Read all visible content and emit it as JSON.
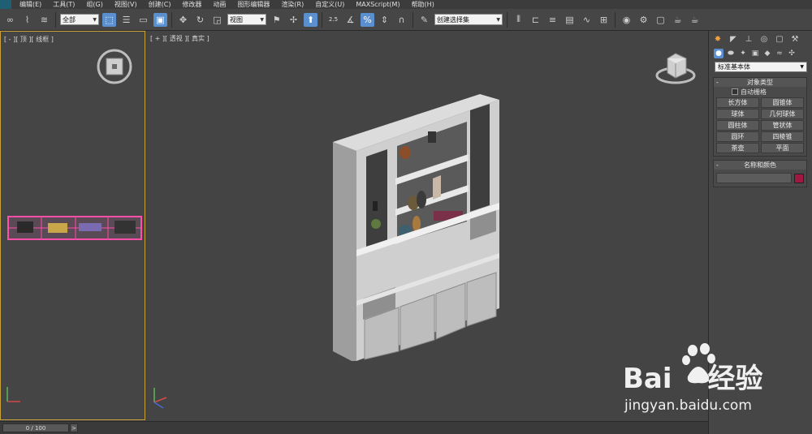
{
  "menubar": {
    "items": [
      "编辑(E)",
      "工具(T)",
      "组(G)",
      "视图(V)",
      "创建(C)",
      "修改器",
      "动画",
      "图形编辑器",
      "渲染(R)",
      "自定义(U)",
      "MAXScript(M)",
      "帮助(H)"
    ]
  },
  "toolbar": {
    "filter_select": "全部",
    "coord_select": "视图",
    "snap_label": "2.5",
    "named_selection": "创建选择集",
    "accent_color": "#5a8fd0"
  },
  "viewports": {
    "top": {
      "label": "[ - ][ 顶 ][ 线框 ]"
    },
    "perspective": {
      "label": "[ + ][ 透视 ][ 真实 ]"
    }
  },
  "command_panel": {
    "primitive_type": "标准基本体",
    "object_type": {
      "title": "对象类型",
      "autogrid": "自动栅格",
      "buttons": [
        "长方体",
        "圆锥体",
        "球体",
        "几何球体",
        "圆柱体",
        "管状体",
        "圆环",
        "四棱锥",
        "茶壶",
        "平面"
      ]
    },
    "name_color": {
      "title": "名称和颜色",
      "swatch_color": "#a0173f"
    }
  },
  "timeline": {
    "frame": "0 / 100",
    "next": ">"
  },
  "watermark": {
    "brand_a": "Bai",
    "brand_b": "经验",
    "url": "jingyan.baidu.com"
  }
}
